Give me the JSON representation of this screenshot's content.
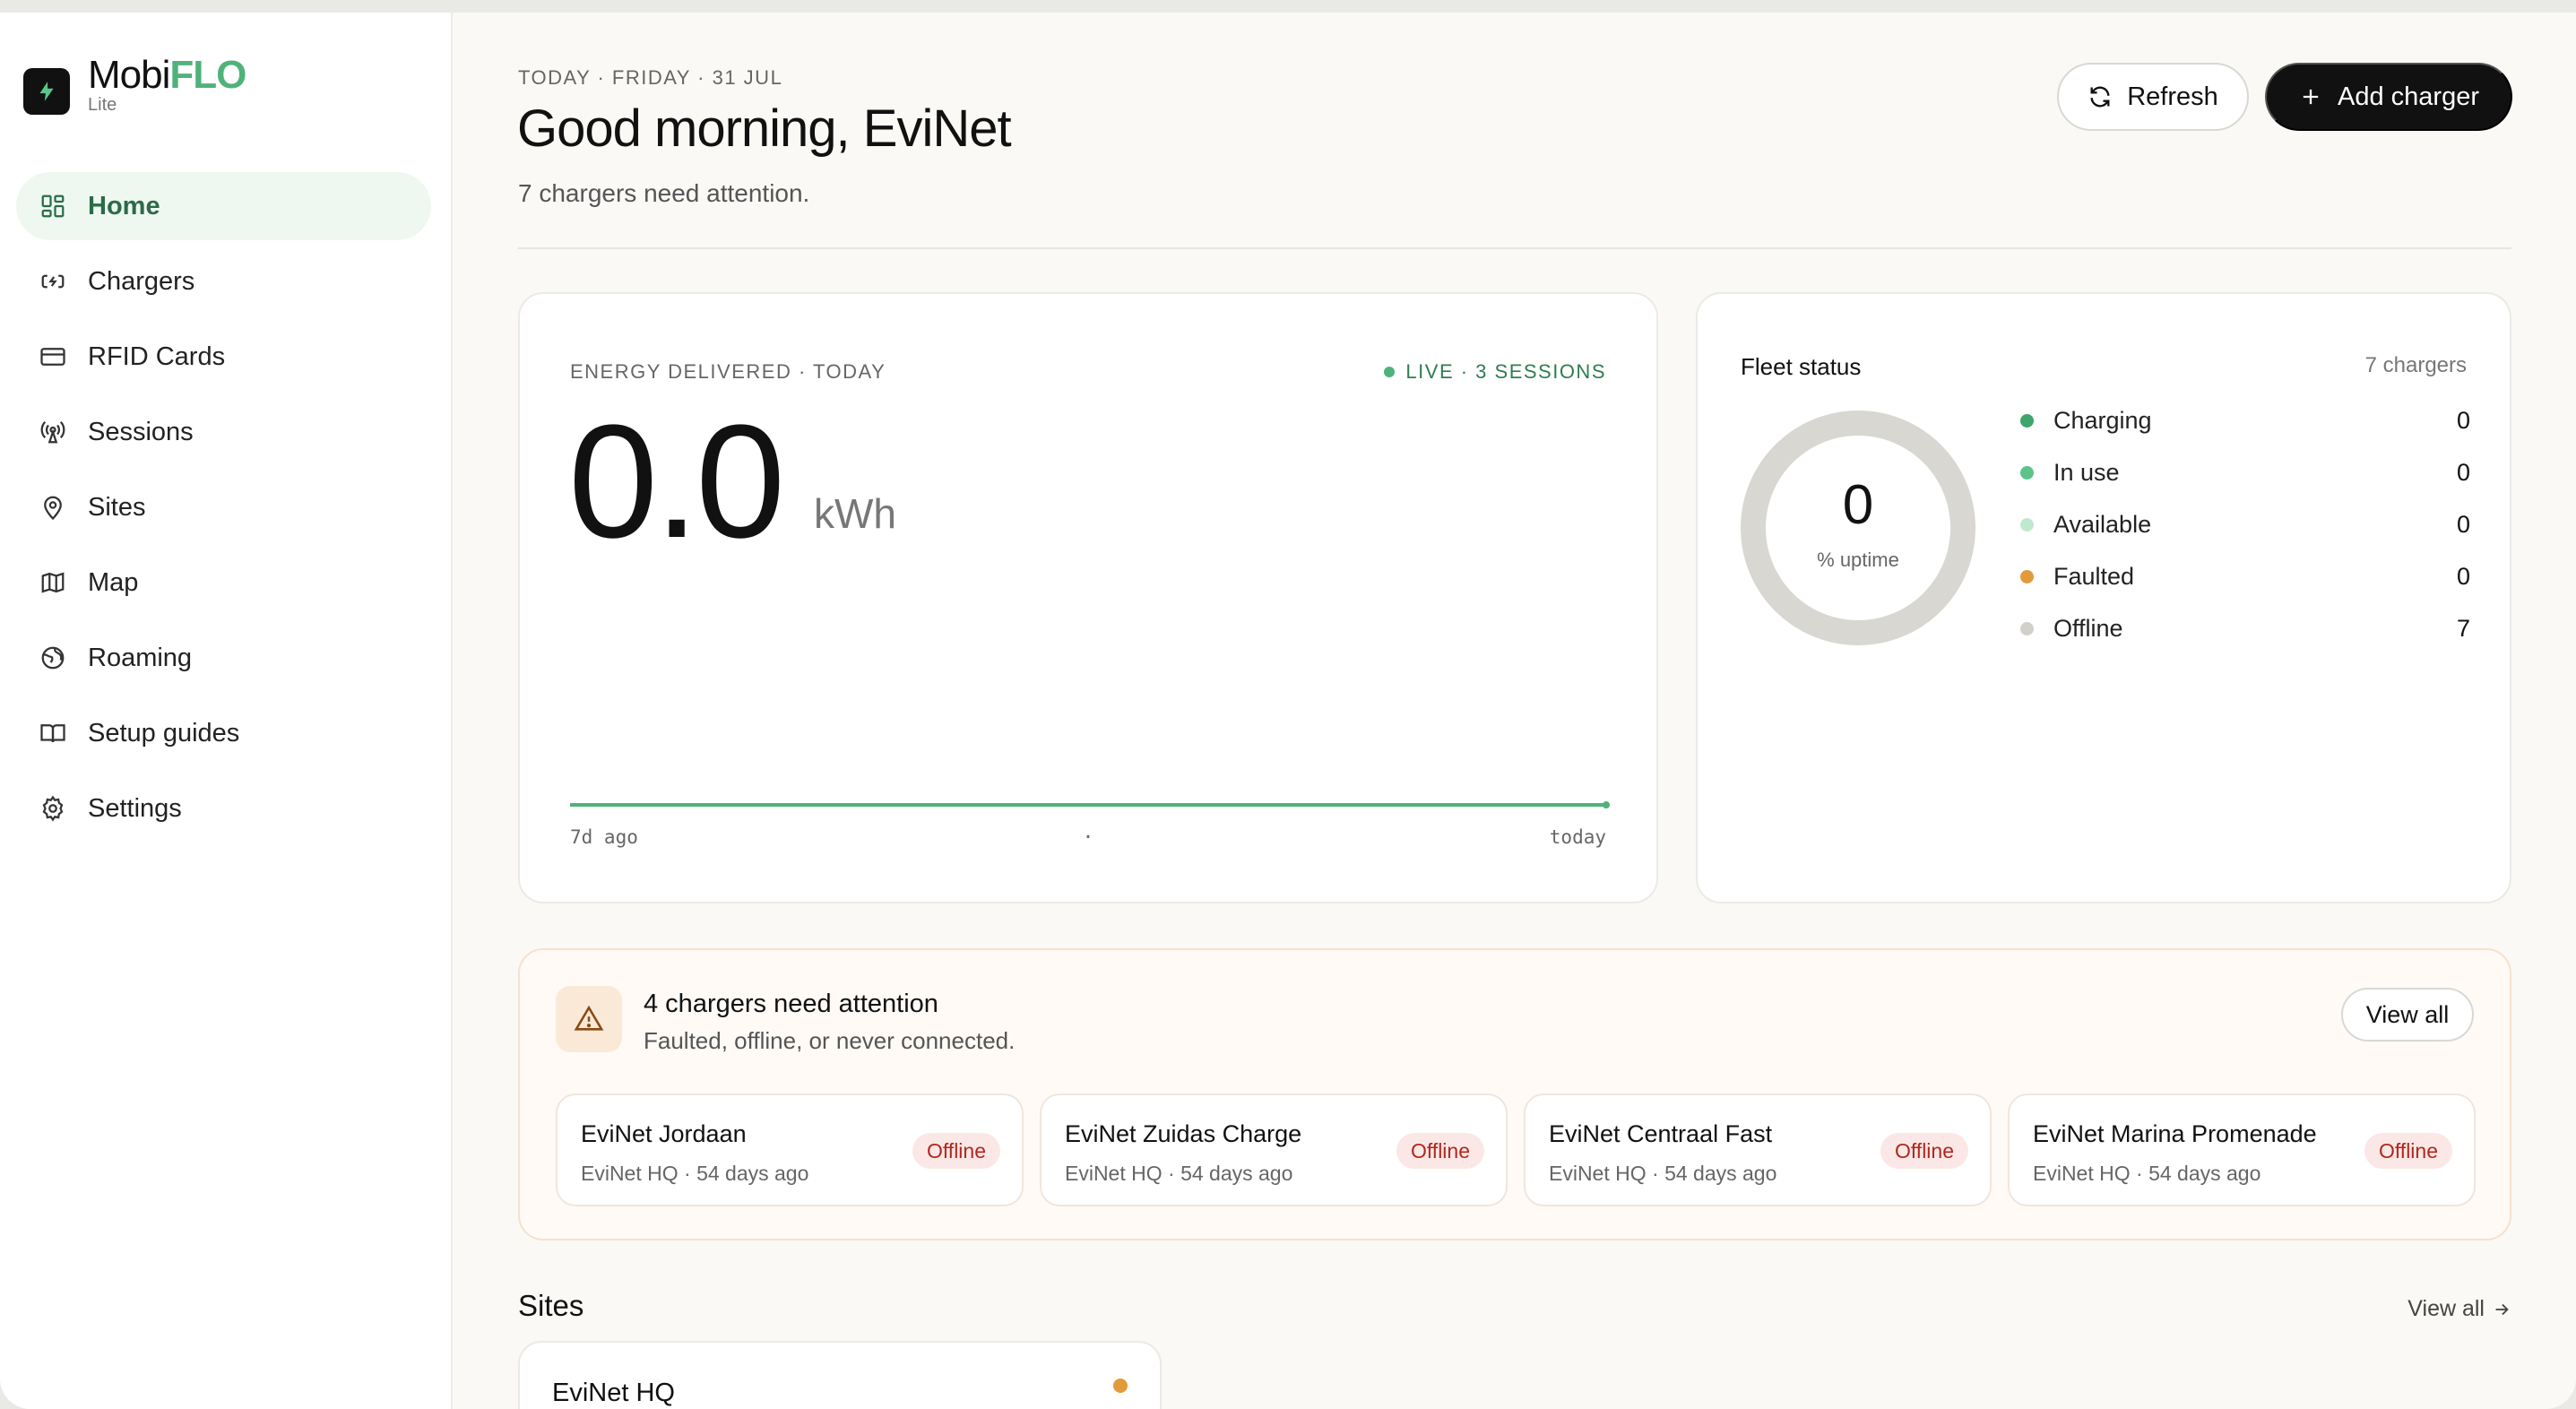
{
  "brand": {
    "name_a": "Mobi",
    "name_b": "FLO",
    "sub": "Lite"
  },
  "nav": [
    {
      "label": "Home",
      "icon": "dashboard-icon",
      "active": true
    },
    {
      "label": "Chargers",
      "icon": "charger-icon"
    },
    {
      "label": "RFID Cards",
      "icon": "card-icon"
    },
    {
      "label": "Sessions",
      "icon": "broadcast-icon"
    },
    {
      "label": "Sites",
      "icon": "pin-icon"
    },
    {
      "label": "Map",
      "icon": "map-icon"
    },
    {
      "label": "Roaming",
      "icon": "globe-icon"
    },
    {
      "label": "Setup guides",
      "icon": "book-icon"
    },
    {
      "label": "Settings",
      "icon": "gear-icon"
    }
  ],
  "header": {
    "date": "TODAY · FRIDAY · 31 JUL",
    "greeting": "Good morning, EviNet",
    "subtitle": "7 chargers need attention.",
    "refresh_label": "Refresh",
    "add_label": "Add charger"
  },
  "energy": {
    "label": "ENERGY DELIVERED · TODAY",
    "live": "LIVE · 3 SESSIONS",
    "value": "0.0",
    "unit": "kWh",
    "axis_left": "7d ago",
    "axis_mid": "·",
    "axis_right": "today",
    "accent": "#4fb27a"
  },
  "fleet": {
    "title": "Fleet status",
    "count": "7 chargers",
    "uptime_value": "0",
    "uptime_label": "% uptime",
    "legend": [
      {
        "label": "Charging",
        "value": "0",
        "color": "#3fa56c"
      },
      {
        "label": "In use",
        "value": "0",
        "color": "#5cc48a"
      },
      {
        "label": "Available",
        "value": "0",
        "color": "#bfe9cf"
      },
      {
        "label": "Faulted",
        "value": "0",
        "color": "#e39a3b"
      },
      {
        "label": "Offline",
        "value": "7",
        "color": "#d1d0cb"
      }
    ]
  },
  "attention": {
    "title": "4 chargers need attention",
    "subtitle": "Faulted, offline, or never connected.",
    "view_all": "View all",
    "chargers": [
      {
        "name": "EviNet Jordaan",
        "meta": "EviNet HQ · 54 days ago",
        "status": "Offline"
      },
      {
        "name": "EviNet Zuidas Charge",
        "meta": "EviNet HQ · 54 days ago",
        "status": "Offline"
      },
      {
        "name": "EviNet Centraal Fast",
        "meta": "EviNet HQ · 54 days ago",
        "status": "Offline"
      },
      {
        "name": "EviNet Marina Promenade",
        "meta": "EviNet HQ · 54 days ago",
        "status": "Offline"
      }
    ]
  },
  "sites": {
    "title": "Sites",
    "view_all": "View all",
    "items": [
      {
        "name": "EviNet HQ",
        "status_color": "#e39a3b"
      }
    ]
  }
}
